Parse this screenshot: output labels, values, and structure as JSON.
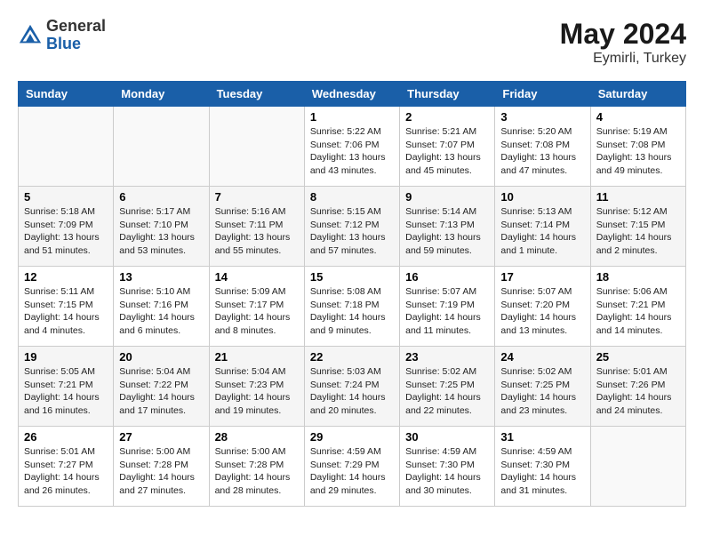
{
  "logo": {
    "general": "General",
    "blue": "Blue"
  },
  "title": {
    "month_year": "May 2024",
    "location": "Eymirli, Turkey"
  },
  "weekdays": [
    "Sunday",
    "Monday",
    "Tuesday",
    "Wednesday",
    "Thursday",
    "Friday",
    "Saturday"
  ],
  "weeks": [
    [
      {
        "day": "",
        "sunrise": "",
        "sunset": "",
        "daylight": ""
      },
      {
        "day": "",
        "sunrise": "",
        "sunset": "",
        "daylight": ""
      },
      {
        "day": "",
        "sunrise": "",
        "sunset": "",
        "daylight": ""
      },
      {
        "day": "1",
        "sunrise": "Sunrise: 5:22 AM",
        "sunset": "Sunset: 7:06 PM",
        "daylight": "Daylight: 13 hours and 43 minutes."
      },
      {
        "day": "2",
        "sunrise": "Sunrise: 5:21 AM",
        "sunset": "Sunset: 7:07 PM",
        "daylight": "Daylight: 13 hours and 45 minutes."
      },
      {
        "day": "3",
        "sunrise": "Sunrise: 5:20 AM",
        "sunset": "Sunset: 7:08 PM",
        "daylight": "Daylight: 13 hours and 47 minutes."
      },
      {
        "day": "4",
        "sunrise": "Sunrise: 5:19 AM",
        "sunset": "Sunset: 7:08 PM",
        "daylight": "Daylight: 13 hours and 49 minutes."
      }
    ],
    [
      {
        "day": "5",
        "sunrise": "Sunrise: 5:18 AM",
        "sunset": "Sunset: 7:09 PM",
        "daylight": "Daylight: 13 hours and 51 minutes."
      },
      {
        "day": "6",
        "sunrise": "Sunrise: 5:17 AM",
        "sunset": "Sunset: 7:10 PM",
        "daylight": "Daylight: 13 hours and 53 minutes."
      },
      {
        "day": "7",
        "sunrise": "Sunrise: 5:16 AM",
        "sunset": "Sunset: 7:11 PM",
        "daylight": "Daylight: 13 hours and 55 minutes."
      },
      {
        "day": "8",
        "sunrise": "Sunrise: 5:15 AM",
        "sunset": "Sunset: 7:12 PM",
        "daylight": "Daylight: 13 hours and 57 minutes."
      },
      {
        "day": "9",
        "sunrise": "Sunrise: 5:14 AM",
        "sunset": "Sunset: 7:13 PM",
        "daylight": "Daylight: 13 hours and 59 minutes."
      },
      {
        "day": "10",
        "sunrise": "Sunrise: 5:13 AM",
        "sunset": "Sunset: 7:14 PM",
        "daylight": "Daylight: 14 hours and 1 minute."
      },
      {
        "day": "11",
        "sunrise": "Sunrise: 5:12 AM",
        "sunset": "Sunset: 7:15 PM",
        "daylight": "Daylight: 14 hours and 2 minutes."
      }
    ],
    [
      {
        "day": "12",
        "sunrise": "Sunrise: 5:11 AM",
        "sunset": "Sunset: 7:15 PM",
        "daylight": "Daylight: 14 hours and 4 minutes."
      },
      {
        "day": "13",
        "sunrise": "Sunrise: 5:10 AM",
        "sunset": "Sunset: 7:16 PM",
        "daylight": "Daylight: 14 hours and 6 minutes."
      },
      {
        "day": "14",
        "sunrise": "Sunrise: 5:09 AM",
        "sunset": "Sunset: 7:17 PM",
        "daylight": "Daylight: 14 hours and 8 minutes."
      },
      {
        "day": "15",
        "sunrise": "Sunrise: 5:08 AM",
        "sunset": "Sunset: 7:18 PM",
        "daylight": "Daylight: 14 hours and 9 minutes."
      },
      {
        "day": "16",
        "sunrise": "Sunrise: 5:07 AM",
        "sunset": "Sunset: 7:19 PM",
        "daylight": "Daylight: 14 hours and 11 minutes."
      },
      {
        "day": "17",
        "sunrise": "Sunrise: 5:07 AM",
        "sunset": "Sunset: 7:20 PM",
        "daylight": "Daylight: 14 hours and 13 minutes."
      },
      {
        "day": "18",
        "sunrise": "Sunrise: 5:06 AM",
        "sunset": "Sunset: 7:21 PM",
        "daylight": "Daylight: 14 hours and 14 minutes."
      }
    ],
    [
      {
        "day": "19",
        "sunrise": "Sunrise: 5:05 AM",
        "sunset": "Sunset: 7:21 PM",
        "daylight": "Daylight: 14 hours and 16 minutes."
      },
      {
        "day": "20",
        "sunrise": "Sunrise: 5:04 AM",
        "sunset": "Sunset: 7:22 PM",
        "daylight": "Daylight: 14 hours and 17 minutes."
      },
      {
        "day": "21",
        "sunrise": "Sunrise: 5:04 AM",
        "sunset": "Sunset: 7:23 PM",
        "daylight": "Daylight: 14 hours and 19 minutes."
      },
      {
        "day": "22",
        "sunrise": "Sunrise: 5:03 AM",
        "sunset": "Sunset: 7:24 PM",
        "daylight": "Daylight: 14 hours and 20 minutes."
      },
      {
        "day": "23",
        "sunrise": "Sunrise: 5:02 AM",
        "sunset": "Sunset: 7:25 PM",
        "daylight": "Daylight: 14 hours and 22 minutes."
      },
      {
        "day": "24",
        "sunrise": "Sunrise: 5:02 AM",
        "sunset": "Sunset: 7:25 PM",
        "daylight": "Daylight: 14 hours and 23 minutes."
      },
      {
        "day": "25",
        "sunrise": "Sunrise: 5:01 AM",
        "sunset": "Sunset: 7:26 PM",
        "daylight": "Daylight: 14 hours and 24 minutes."
      }
    ],
    [
      {
        "day": "26",
        "sunrise": "Sunrise: 5:01 AM",
        "sunset": "Sunset: 7:27 PM",
        "daylight": "Daylight: 14 hours and 26 minutes."
      },
      {
        "day": "27",
        "sunrise": "Sunrise: 5:00 AM",
        "sunset": "Sunset: 7:28 PM",
        "daylight": "Daylight: 14 hours and 27 minutes."
      },
      {
        "day": "28",
        "sunrise": "Sunrise: 5:00 AM",
        "sunset": "Sunset: 7:28 PM",
        "daylight": "Daylight: 14 hours and 28 minutes."
      },
      {
        "day": "29",
        "sunrise": "Sunrise: 4:59 AM",
        "sunset": "Sunset: 7:29 PM",
        "daylight": "Daylight: 14 hours and 29 minutes."
      },
      {
        "day": "30",
        "sunrise": "Sunrise: 4:59 AM",
        "sunset": "Sunset: 7:30 PM",
        "daylight": "Daylight: 14 hours and 30 minutes."
      },
      {
        "day": "31",
        "sunrise": "Sunrise: 4:59 AM",
        "sunset": "Sunset: 7:30 PM",
        "daylight": "Daylight: 14 hours and 31 minutes."
      },
      {
        "day": "",
        "sunrise": "",
        "sunset": "",
        "daylight": ""
      }
    ]
  ]
}
